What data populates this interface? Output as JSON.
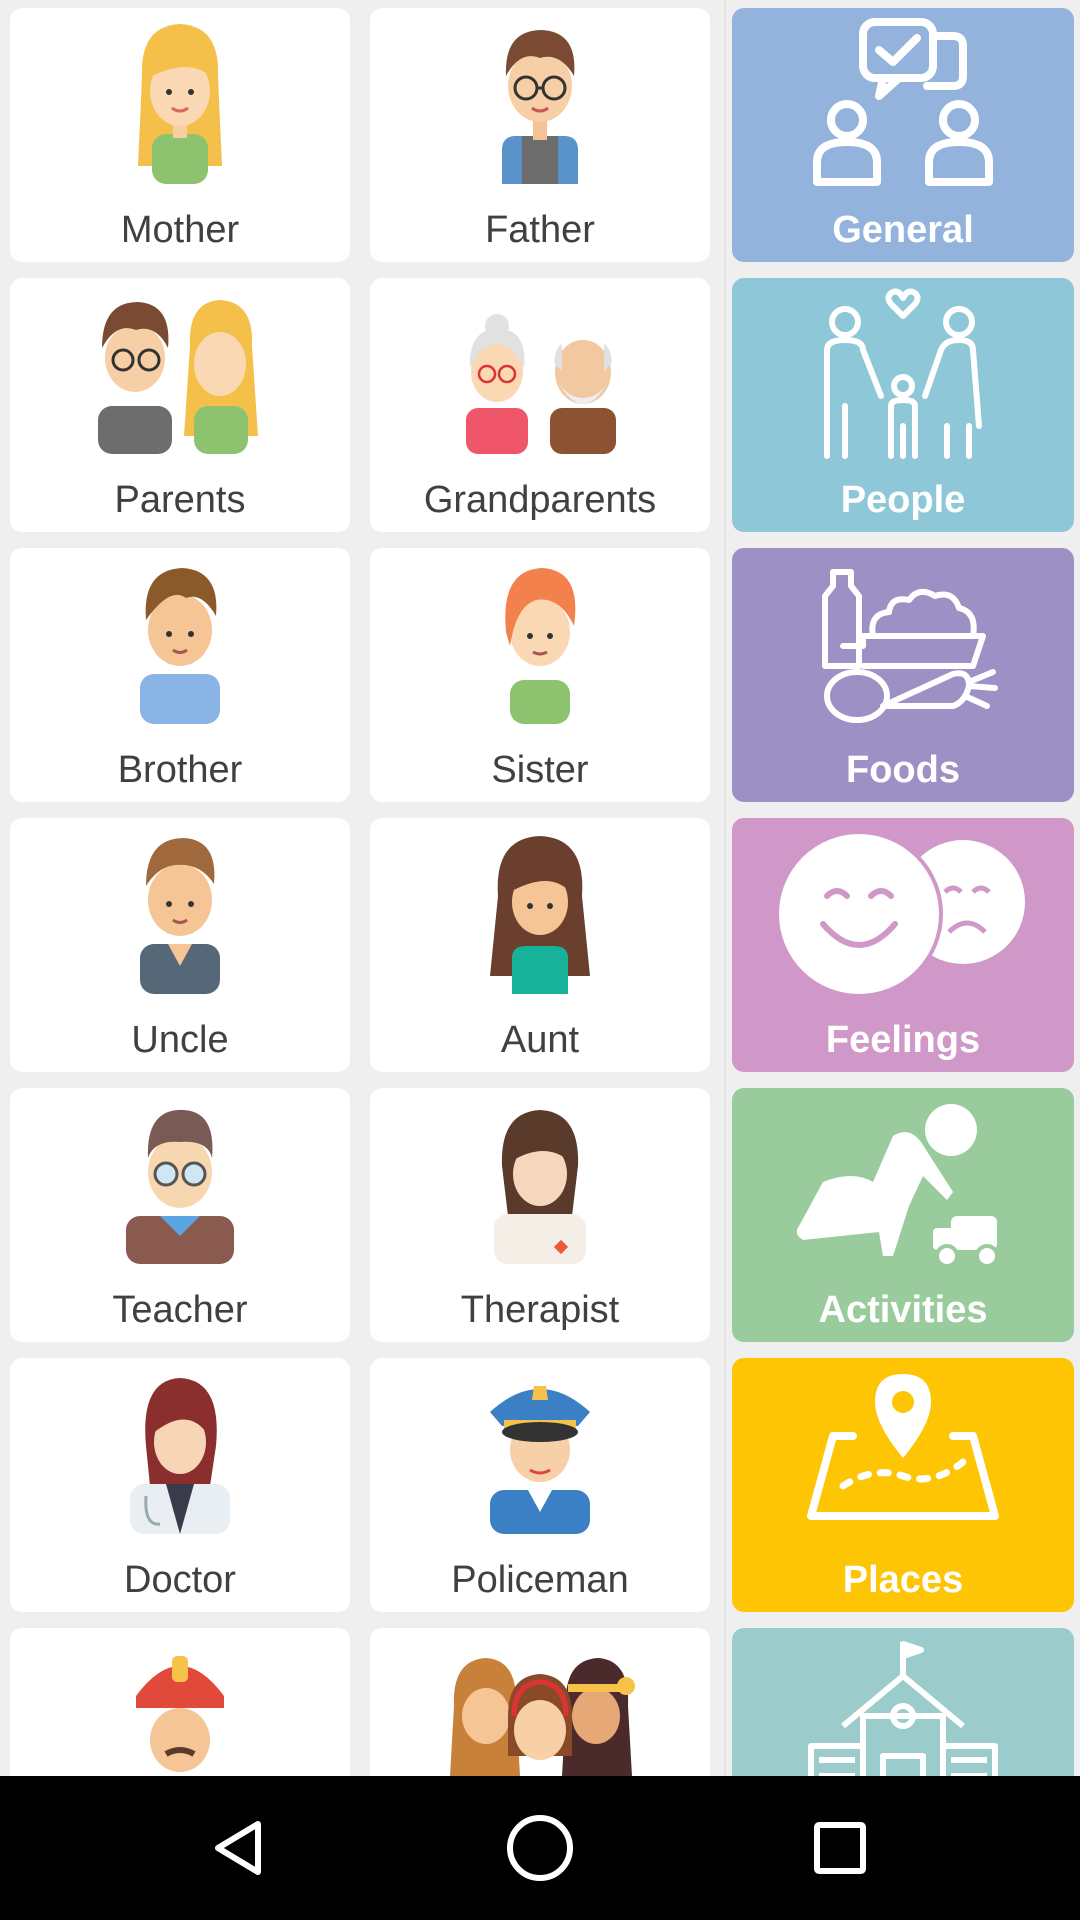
{
  "people": [
    {
      "label": "Mother",
      "icon": "mother-icon"
    },
    {
      "label": "Father",
      "icon": "father-icon"
    },
    {
      "label": "Parents",
      "icon": "parents-icon"
    },
    {
      "label": "Grandparents",
      "icon": "grandparents-icon"
    },
    {
      "label": "Brother",
      "icon": "brother-icon"
    },
    {
      "label": "Sister",
      "icon": "sister-icon"
    },
    {
      "label": "Uncle",
      "icon": "uncle-icon"
    },
    {
      "label": "Aunt",
      "icon": "aunt-icon"
    },
    {
      "label": "Teacher",
      "icon": "teacher-icon"
    },
    {
      "label": "Therapist",
      "icon": "therapist-icon"
    },
    {
      "label": "Doctor",
      "icon": "doctor-icon"
    },
    {
      "label": "Policeman",
      "icon": "policeman-icon"
    },
    {
      "label": "",
      "icon": "firefighter-icon"
    },
    {
      "label": "",
      "icon": "friends-icon"
    }
  ],
  "categories": [
    {
      "label": "General",
      "icon": "general-chat-icon",
      "color": "#94b3dc"
    },
    {
      "label": "People",
      "icon": "family-icon",
      "color": "#8ec8d8"
    },
    {
      "label": "Foods",
      "icon": "groceries-icon",
      "color": "#9d90c4"
    },
    {
      "label": "Feelings",
      "icon": "feelings-faces-icon",
      "color": "#cf98c8"
    },
    {
      "label": "Activities",
      "icon": "child-playing-icon",
      "color": "#99cb9d"
    },
    {
      "label": "Places",
      "icon": "map-pin-icon",
      "color": "#fdc503"
    },
    {
      "label": "",
      "icon": "school-building-icon",
      "color": "#9ccbcb"
    }
  ],
  "navbar": {
    "back": "back-icon",
    "home": "home-icon",
    "recents": "recents-icon"
  }
}
